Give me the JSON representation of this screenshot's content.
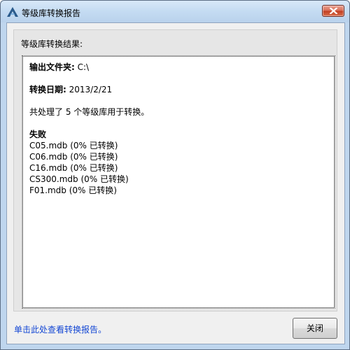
{
  "window": {
    "title": "等级库转换报告",
    "icon": "autodesk-a-icon",
    "close_icon": "close-icon"
  },
  "group": {
    "label": "等级库转换结果:"
  },
  "report": {
    "output_folder_label": "输出文件夹:",
    "output_folder_value": " C:\\",
    "date_label": "转换日期:",
    "date_value": " 2013/2/21",
    "summary": "共处理了 5 个等级库用于转换。",
    "failed_heading": "失败",
    "failed_items": [
      "C05.mdb (0% 已转换)",
      "C06.mdb (0% 已转换)",
      "C16.mdb (0% 已转换)",
      "CS300.mdb (0% 已转换)",
      "F01.mdb (0% 已转换)"
    ]
  },
  "footer": {
    "link_text": "单击此处查看转换报告。",
    "close_button_label": "关闭"
  },
  "colors": {
    "link": "#1447d4",
    "title_bar": "#c4dbf2",
    "close_button": "#c23f22"
  }
}
